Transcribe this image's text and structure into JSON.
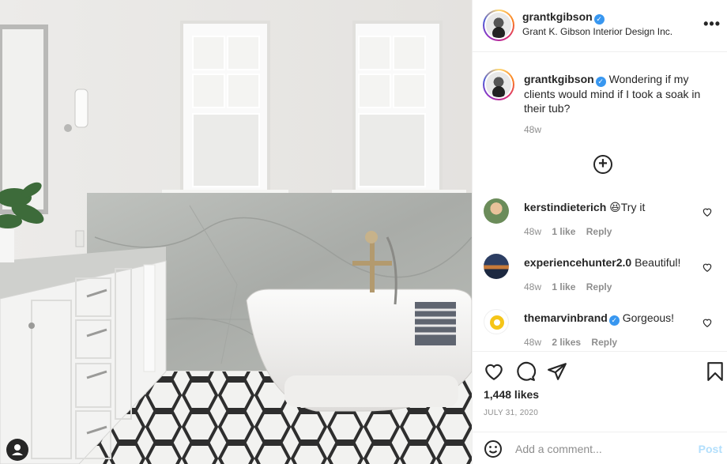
{
  "post": {
    "username": "grantkgibson",
    "subtitle": "Grant K. Gibson Interior Design Inc.",
    "verified_glyph": "✓",
    "more_glyph": "•••"
  },
  "caption": {
    "username": "grantkgibson",
    "text": "Wondering if my clients would mind if I took a soak in their tub?",
    "time": "48w"
  },
  "comments": [
    {
      "username": "kerstindieterich",
      "emoji": "😆",
      "text": "Try it",
      "time": "48w",
      "likes": "1 like",
      "reply": "Reply",
      "verified": false
    },
    {
      "username": "experiencehunter2.0",
      "emoji": "",
      "text": "Beautiful!",
      "time": "48w",
      "likes": "1 like",
      "reply": "Reply",
      "verified": false
    },
    {
      "username": "themarvinbrand",
      "emoji": "",
      "text": "Gorgeous!",
      "time": "48w",
      "likes": "2 likes",
      "reply": "Reply",
      "verified": true
    }
  ],
  "actions": {
    "likes": "1,448 likes",
    "date": "JULY 31, 2020"
  },
  "add_comment": {
    "placeholder": "Add a comment...",
    "post_label": "Post"
  },
  "icons": {
    "like": "heart-icon",
    "comment": "comment-icon",
    "share": "share-icon",
    "save": "bookmark-icon",
    "emoji": "smile-icon",
    "user_tag": "user-tag-icon"
  },
  "colors": {
    "verified": "#3897f0",
    "post_disabled": "#b2dffc",
    "muted": "#8e8e8e"
  }
}
